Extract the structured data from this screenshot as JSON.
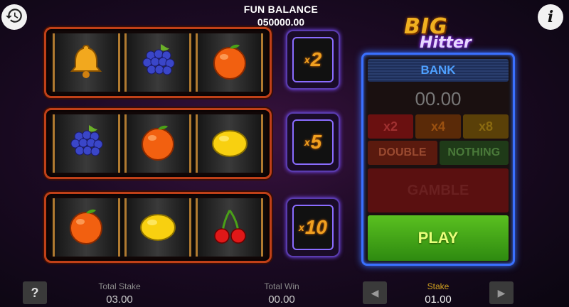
{
  "header": {
    "balance_label": "FUN BALANCE",
    "balance_value": "050000.00"
  },
  "logo": {
    "line1": "BIG",
    "line2": "Hitter"
  },
  "reels": [
    {
      "symbols": [
        "bell",
        "grapes",
        "orange"
      ],
      "multiplier_prefix": "x",
      "multiplier": "2"
    },
    {
      "symbols": [
        "grapes",
        "orange",
        "lemon"
      ],
      "multiplier_prefix": "x",
      "multiplier": "5"
    },
    {
      "symbols": [
        "orange",
        "lemon",
        "cherries"
      ],
      "multiplier_prefix": "x",
      "multiplier": "10"
    }
  ],
  "panel": {
    "bank_label": "BANK",
    "bank_value": "00.00",
    "x2": "x2",
    "x4": "x4",
    "x8": "x8",
    "double": "DOUBLE",
    "nothing": "NOTHING",
    "gamble": "GAMBLE",
    "play": "PLAY"
  },
  "footer": {
    "help": "?",
    "total_stake_label": "Total Stake",
    "total_stake_value": "03.00",
    "total_win_label": "Total Win",
    "total_win_value": "00.00",
    "stake_label": "Stake",
    "stake_value": "01.00"
  },
  "icons": {
    "history": "history-icon",
    "info": "info-icon",
    "stake_down": "chevron-left-icon",
    "stake_up": "chevron-right-icon"
  },
  "colors": {
    "reel_border": "#c04018",
    "panel_border": "#3a70ff",
    "play": "#4aa818",
    "multiplier": "#f0a020"
  }
}
